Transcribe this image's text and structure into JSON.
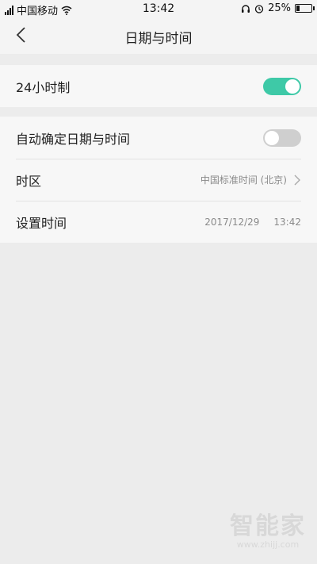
{
  "status_bar": {
    "carrier": "中国移动",
    "time": "13:42",
    "battery": "25%",
    "battery_level": 0.25,
    "icons": [
      "signal-icon",
      "wifi-icon",
      "headset-icon",
      "alarm-icon",
      "battery-icon"
    ]
  },
  "header": {
    "title": "日期与时间",
    "back_icon": "chevron-left-icon"
  },
  "sections": {
    "clock": {
      "label": "24小时制",
      "enabled": true
    },
    "auto": {
      "label": "自动确定日期与时间",
      "enabled": false
    },
    "timezone": {
      "label": "时区",
      "value": "中国标准时间 (北京)"
    },
    "set_time": {
      "label": "设置时间",
      "date": "2017/12/29",
      "time": "13:42"
    }
  },
  "watermark": {
    "main": "智能家",
    "sub": "www.zhijj.com"
  },
  "colors": {
    "accent": "#3ec9a7",
    "toggle_off": "#cfcfcf",
    "background": "#ececec"
  }
}
